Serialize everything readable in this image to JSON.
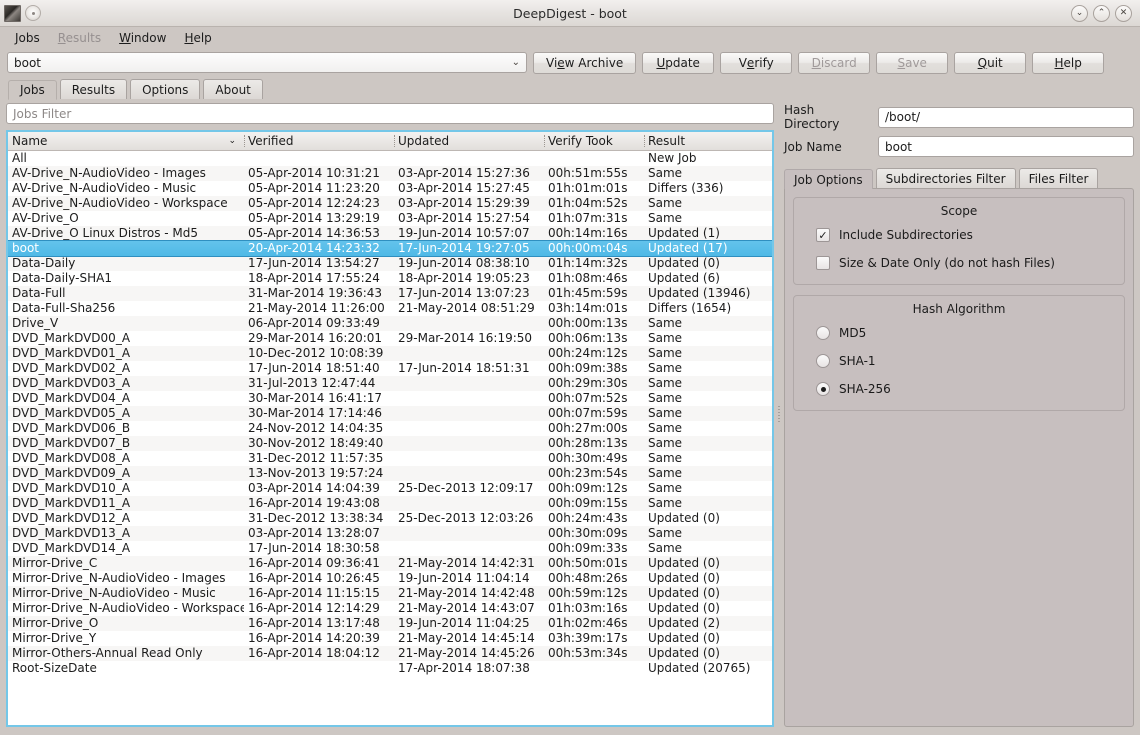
{
  "window": {
    "title": "DeepDigest - boot",
    "controls": [
      {
        "name": "minimize",
        "glyph": "⌄"
      },
      {
        "name": "maximize",
        "glyph": "⌃"
      },
      {
        "name": "close",
        "glyph": "✕"
      }
    ]
  },
  "menubar": [
    {
      "label": "Jobs",
      "mnemonic": "J",
      "disabled": false
    },
    {
      "label": "Results",
      "mnemonic": "R",
      "disabled": true
    },
    {
      "label": "Window",
      "mnemonic": "W",
      "disabled": false
    },
    {
      "label": "Help",
      "mnemonic": "H",
      "disabled": false
    }
  ],
  "toolbar": {
    "job_combo_value": "boot",
    "chevron": "⌄",
    "buttons": [
      {
        "label": "View Archive",
        "disabled": false
      },
      {
        "label": "Update",
        "disabled": false
      },
      {
        "label": "Verify",
        "disabled": false
      },
      {
        "label": "Discard",
        "disabled": true
      },
      {
        "label": "Save",
        "disabled": true
      },
      {
        "label": "Quit",
        "disabled": false
      },
      {
        "label": "Help",
        "disabled": false
      }
    ]
  },
  "tabs": [
    {
      "label": "Jobs",
      "active": true
    },
    {
      "label": "Results",
      "active": false
    },
    {
      "label": "Options",
      "active": false
    },
    {
      "label": "About",
      "active": false
    }
  ],
  "jobs_filter": {
    "value": "",
    "placeholder": "Jobs Filter"
  },
  "table": {
    "columns": [
      "Name",
      "Verified",
      "Updated",
      "Verify Took",
      "Result"
    ],
    "sort_column": "Name",
    "sort_glyph": "⌄",
    "rows": [
      {
        "name": "All",
        "verified": "",
        "updated": "",
        "took": "",
        "result": "New Job",
        "selected": false
      },
      {
        "name": "AV-Drive_N-AudioVideo - Images",
        "verified": "05-Apr-2014 10:31:21",
        "updated": "03-Apr-2014 15:27:36",
        "took": "00h:51m:55s",
        "result": "Same",
        "selected": false
      },
      {
        "name": "AV-Drive_N-AudioVideo - Music",
        "verified": "05-Apr-2014 11:23:20",
        "updated": "03-Apr-2014 15:27:45",
        "took": "01h:01m:01s",
        "result": "Differs (336)",
        "selected": false
      },
      {
        "name": "AV-Drive_N-AudioVideo - Workspace",
        "verified": "05-Apr-2014 12:24:23",
        "updated": "03-Apr-2014 15:29:39",
        "took": "01h:04m:52s",
        "result": "Same",
        "selected": false
      },
      {
        "name": "AV-Drive_O",
        "verified": "05-Apr-2014 13:29:19",
        "updated": "03-Apr-2014 15:27:54",
        "took": "01h:07m:31s",
        "result": "Same",
        "selected": false
      },
      {
        "name": "AV-Drive_O Linux Distros - Md5",
        "verified": "05-Apr-2014 14:36:53",
        "updated": "19-Jun-2014 10:57:07",
        "took": "00h:14m:16s",
        "result": "Updated (1)",
        "selected": false
      },
      {
        "name": "boot",
        "verified": "20-Apr-2014 14:23:32",
        "updated": "17-Jun-2014 19:27:05",
        "took": "00h:00m:04s",
        "result": "Updated (17)",
        "selected": true
      },
      {
        "name": "Data-Daily",
        "verified": "17-Jun-2014 13:54:27",
        "updated": "19-Jun-2014 08:38:10",
        "took": "01h:14m:32s",
        "result": "Updated (0)",
        "selected": false
      },
      {
        "name": "Data-Daily-SHA1",
        "verified": "18-Apr-2014 17:55:24",
        "updated": "18-Apr-2014 19:05:23",
        "took": "01h:08m:46s",
        "result": "Updated (6)",
        "selected": false
      },
      {
        "name": "Data-Full",
        "verified": "31-Mar-2014 19:36:43",
        "updated": "17-Jun-2014 13:07:23",
        "took": "01h:45m:59s",
        "result": "Updated (13946)",
        "selected": false
      },
      {
        "name": "Data-Full-Sha256",
        "verified": "21-May-2014 11:26:00",
        "updated": "21-May-2014 08:51:29",
        "took": "03h:14m:01s",
        "result": "Differs (1654)",
        "selected": false
      },
      {
        "name": "Drive_V",
        "verified": "06-Apr-2014 09:33:49",
        "updated": "",
        "took": "00h:00m:13s",
        "result": "Same",
        "selected": false
      },
      {
        "name": "DVD_MarkDVD00_A",
        "verified": "29-Mar-2014 16:20:01",
        "updated": "29-Mar-2014 16:19:50",
        "took": "00h:06m:13s",
        "result": "Same",
        "selected": false
      },
      {
        "name": "DVD_MarkDVD01_A",
        "verified": "10-Dec-2012 10:08:39",
        "updated": "",
        "took": "00h:24m:12s",
        "result": "Same",
        "selected": false
      },
      {
        "name": "DVD_MarkDVD02_A",
        "verified": "17-Jun-2014 18:51:40",
        "updated": "17-Jun-2014 18:51:31",
        "took": "00h:09m:38s",
        "result": "Same",
        "selected": false
      },
      {
        "name": "DVD_MarkDVD03_A",
        "verified": "31-Jul-2013 12:47:44",
        "updated": "",
        "took": "00h:29m:30s",
        "result": "Same",
        "selected": false
      },
      {
        "name": "DVD_MarkDVD04_A",
        "verified": "30-Mar-2014 16:41:17",
        "updated": "",
        "took": "00h:07m:52s",
        "result": "Same",
        "selected": false
      },
      {
        "name": "DVD_MarkDVD05_A",
        "verified": "30-Mar-2014 17:14:46",
        "updated": "",
        "took": "00h:07m:59s",
        "result": "Same",
        "selected": false
      },
      {
        "name": "DVD_MarkDVD06_B",
        "verified": "24-Nov-2012 14:04:35",
        "updated": "",
        "took": "00h:27m:00s",
        "result": "Same",
        "selected": false
      },
      {
        "name": "DVD_MarkDVD07_B",
        "verified": "30-Nov-2012 18:49:40",
        "updated": "",
        "took": "00h:28m:13s",
        "result": "Same",
        "selected": false
      },
      {
        "name": "DVD_MarkDVD08_A",
        "verified": "31-Dec-2012 11:57:35",
        "updated": "",
        "took": "00h:30m:49s",
        "result": "Same",
        "selected": false
      },
      {
        "name": "DVD_MarkDVD09_A",
        "verified": "13-Nov-2013 19:57:24",
        "updated": "",
        "took": "00h:23m:54s",
        "result": "Same",
        "selected": false
      },
      {
        "name": "DVD_MarkDVD10_A",
        "verified": "03-Apr-2014 14:04:39",
        "updated": "25-Dec-2013 12:09:17",
        "took": "00h:09m:12s",
        "result": "Same",
        "selected": false
      },
      {
        "name": "DVD_MarkDVD11_A",
        "verified": "16-Apr-2014 19:43:08",
        "updated": "",
        "took": "00h:09m:15s",
        "result": "Same",
        "selected": false
      },
      {
        "name": "DVD_MarkDVD12_A",
        "verified": "31-Dec-2012 13:38:34",
        "updated": "25-Dec-2013 12:03:26",
        "took": "00h:24m:43s",
        "result": "Updated (0)",
        "selected": false
      },
      {
        "name": "DVD_MarkDVD13_A",
        "verified": "03-Apr-2014 13:28:07",
        "updated": "",
        "took": "00h:30m:09s",
        "result": "Same",
        "selected": false
      },
      {
        "name": "DVD_MarkDVD14_A",
        "verified": "17-Jun-2014 18:30:58",
        "updated": "",
        "took": "00h:09m:33s",
        "result": "Same",
        "selected": false
      },
      {
        "name": "Mirror-Drive_C",
        "verified": "16-Apr-2014 09:36:41",
        "updated": "21-May-2014 14:42:31",
        "took": "00h:50m:01s",
        "result": "Updated (0)",
        "selected": false
      },
      {
        "name": "Mirror-Drive_N-AudioVideo - Images",
        "verified": "16-Apr-2014 10:26:45",
        "updated": "19-Jun-2014 11:04:14",
        "took": "00h:48m:26s",
        "result": "Updated (0)",
        "selected": false
      },
      {
        "name": "Mirror-Drive_N-AudioVideo - Music",
        "verified": "16-Apr-2014 11:15:15",
        "updated": "21-May-2014 14:42:48",
        "took": "00h:59m:12s",
        "result": "Updated (0)",
        "selected": false
      },
      {
        "name": "Mirror-Drive_N-AudioVideo - Workspace",
        "verified": "16-Apr-2014 12:14:29",
        "updated": "21-May-2014 14:43:07",
        "took": "01h:03m:16s",
        "result": "Updated (0)",
        "selected": false
      },
      {
        "name": "Mirror-Drive_O",
        "verified": "16-Apr-2014 13:17:48",
        "updated": "19-Jun-2014 11:04:25",
        "took": "01h:02m:46s",
        "result": "Updated (2)",
        "selected": false
      },
      {
        "name": "Mirror-Drive_Y",
        "verified": "16-Apr-2014 14:20:39",
        "updated": "21-May-2014 14:45:14",
        "took": "03h:39m:17s",
        "result": "Updated (0)",
        "selected": false
      },
      {
        "name": "Mirror-Others-Annual Read Only",
        "verified": "16-Apr-2014 18:04:12",
        "updated": "21-May-2014 14:45:26",
        "took": "00h:53m:34s",
        "result": "Updated (0)",
        "selected": false
      },
      {
        "name": "Root-SizeDate",
        "verified": "",
        "updated": "17-Apr-2014 18:07:38",
        "took": "",
        "result": "Updated (20765)",
        "selected": false
      }
    ]
  },
  "panel": {
    "hash_directory": {
      "label": "Hash Directory",
      "value": "/boot/"
    },
    "job_name": {
      "label": "Job Name",
      "value": "boot"
    },
    "tabs": [
      {
        "label": "Job Options",
        "active": true
      },
      {
        "label": "Subdirectories Filter",
        "active": false
      },
      {
        "label": "Files Filter",
        "active": false
      }
    ],
    "scope": {
      "title": "Scope",
      "options": [
        {
          "label": "Include Subdirectories",
          "checked": true
        },
        {
          "label": "Size & Date Only (do not hash Files)",
          "checked": false
        }
      ]
    },
    "hash_algorithm": {
      "title": "Hash Algorithm",
      "options": [
        {
          "label": "MD5",
          "selected": false
        },
        {
          "label": "SHA-1",
          "selected": false
        },
        {
          "label": "SHA-256",
          "selected": true
        }
      ]
    }
  },
  "colors": {
    "selection": "#58bfe9",
    "panel_bg": "#c7bfbf",
    "window_bg": "#cdc7c3",
    "focus_border": "#74c7e8"
  }
}
